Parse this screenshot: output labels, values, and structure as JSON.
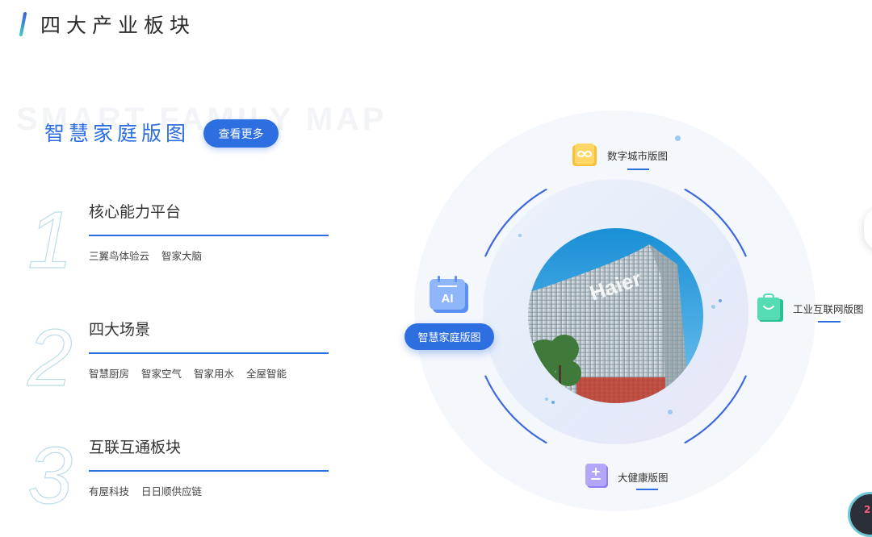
{
  "header": {
    "title": "四大产业板块"
  },
  "left": {
    "watermark": "SMART FAMILY MAP",
    "section_title": "智慧家庭版图",
    "more_label": "查看更多",
    "features": [
      {
        "number": "1",
        "heading": "核心能力平台",
        "tags": [
          "三翼鸟体验云",
          "智家大脑"
        ]
      },
      {
        "number": "2",
        "heading": "四大场景",
        "tags": [
          "智慧厨房",
          "智家空气",
          "智家用水",
          "全屋智能"
        ]
      },
      {
        "number": "3",
        "heading": "互联互通板块",
        "tags": [
          "有屋科技",
          "日日顺供应链"
        ]
      }
    ]
  },
  "map": {
    "active": {
      "label": "智慧家庭版图",
      "icon_text": "AI"
    },
    "nodes": {
      "top": "数字城市版图",
      "right": "工业互联网版图",
      "bottom": "大健康版图"
    },
    "photo_sign": "Haier",
    "corner_badge": "2"
  },
  "colors": {
    "accent": "#2d6ee0",
    "outline_number": "#bcdce8"
  },
  "icons": {
    "top": "infinity-icon",
    "right": "shopping-bag-icon",
    "bottom": "health-cross-icon",
    "active": "ai-calendar-icon"
  }
}
